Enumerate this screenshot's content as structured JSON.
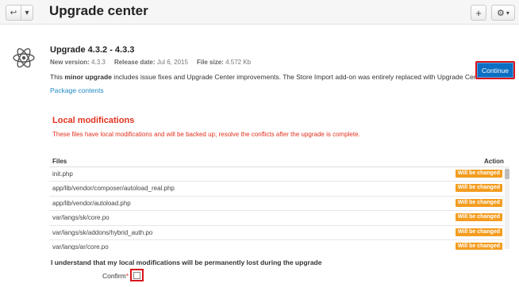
{
  "header": {
    "title": "Upgrade center",
    "back_icon": "↩",
    "dropdown_icon": "▾",
    "add_icon": "+",
    "gear_icon": "⚙"
  },
  "upgrade": {
    "title": "Upgrade 4.3.2 - 4.3.3",
    "new_version_label": "New version:",
    "new_version": "4.3.3",
    "release_date_label": "Release date:",
    "release_date": "Jul 6, 2015",
    "file_size_label": "File size:",
    "file_size": "4.572 Kb",
    "desc_prefix": "This ",
    "desc_bold": "minor upgrade",
    "desc_suffix": " includes issue fixes and Upgrade Center improvements. The Store Import add-on was entirely replaced with Upgrade Center.",
    "package_link": "Package contents",
    "continue_label": "Continue"
  },
  "local_modifications": {
    "title": "Local modifications",
    "text": "These files have local modifications and will be backed up; resolve the conflicts after the upgrade is complete.",
    "col_files": "Files",
    "col_action": "Action",
    "rows": [
      {
        "file": "init.php",
        "action": "Will be changed"
      },
      {
        "file": "app/lib/vendor/composer/autoload_real.php",
        "action": "Will be changed"
      },
      {
        "file": "app/lib/vendor/autoload.php",
        "action": "Will be changed"
      },
      {
        "file": "var/langs/sk/core.po",
        "action": "Will be changed"
      },
      {
        "file": "var/langs/sk/addons/hybrid_auth.po",
        "action": "Will be changed"
      },
      {
        "file": "var/langs/ar/core.po",
        "action": "Will be changed"
      }
    ]
  },
  "confirm": {
    "statement": "I understand that my local modifications will be permanently lost during the upgrade",
    "label": "Confirm",
    "required_mark": "*",
    "checked": false
  },
  "colors": {
    "accent_blue": "#0c6fc3",
    "warning_red": "#e2321f",
    "badge_orange": "#f39c1f",
    "highlight_red": "#d9131b"
  }
}
